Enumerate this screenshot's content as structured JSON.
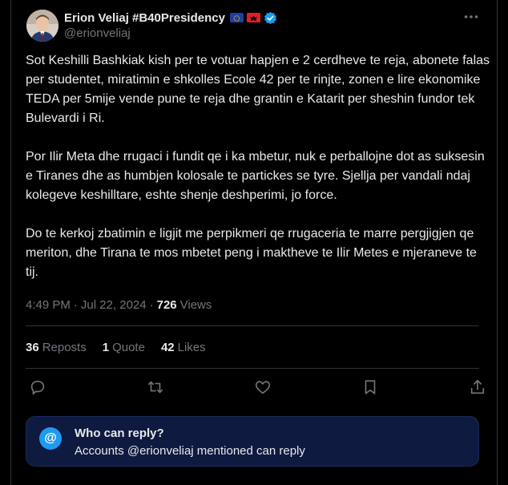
{
  "author": {
    "name": "Erion Veliaj #B40Presidency",
    "handle": "@erionveliaj",
    "flags": [
      "eu-flag-icon",
      "albania-flag-icon"
    ],
    "verified": true
  },
  "tweet": {
    "paragraphs": [
      "Sot Keshilli Bashkiak kish per te votuar hapjen e 2 cerdheve te reja, abonete falas per studentet, miratimin e shkolles Ecole 42 per te rinjte, zonen e lire ekonomike TEDA per 5mije vende pune te reja dhe grantin e Katarit per sheshin fundor tek Bulevardi i Ri.",
      "Por Ilir Meta dhe rrugaci i fundit qe i ka mbetur, nuk e perballojne dot as suksesin e Tiranes dhe as humbjen kolosale te partickes se tyre. Sjellja per vandali ndaj kolegeve keshilltare, eshte shenje deshperimi, jo force.",
      "Do te kerkoj zbatimin e ligjit me perpikmeri qe rrugaceria te marre pergjigjen qe meriton, dhe Tirana te mos mbetet peng i maktheve te Ilir Metes e mjeraneve te tij."
    ],
    "time": "4:49 PM",
    "separator": "·",
    "date": "Jul 22, 2024",
    "views_count": "726",
    "views_label": "Views"
  },
  "stats": {
    "reposts_count": "36",
    "reposts_label": "Reposts",
    "quotes_count": "1",
    "quotes_label": "Quote",
    "likes_count": "42",
    "likes_label": "Likes"
  },
  "actions": [
    "reply-icon",
    "repost-icon",
    "like-icon",
    "bookmark-icon",
    "share-icon"
  ],
  "reply_restriction": {
    "badge": "@",
    "title": "Who can reply?",
    "subtitle": "Accounts @erionveliaj mentioned can reply"
  },
  "colors": {
    "background": "#000000",
    "text": "#e7e9ea",
    "muted": "#71767b",
    "accent": "#1d9bf0",
    "divider": "#2f3336",
    "reply_box": "#0e1a3f"
  }
}
